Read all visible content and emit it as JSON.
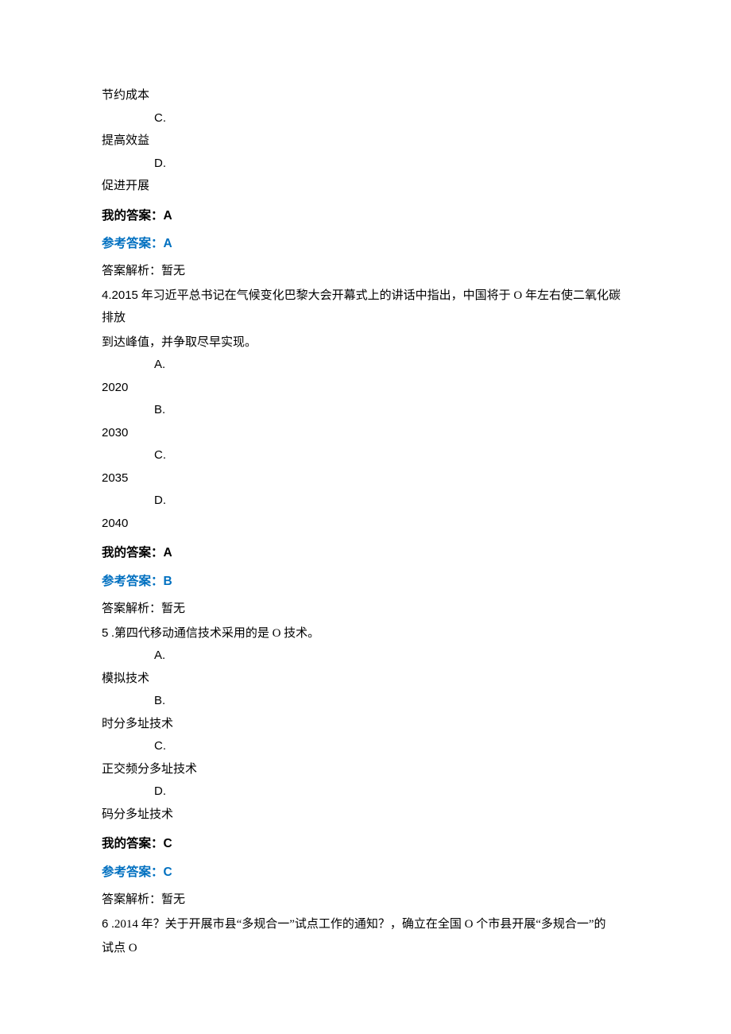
{
  "lead_options": {
    "opt_b_text": "节约成本",
    "opt_c_label": "C.",
    "opt_c_text": "提高效益",
    "opt_d_label": "D.",
    "opt_d_text": "促进开展"
  },
  "q3": {
    "my_label": "我的答案：",
    "my_value": "A",
    "ref_label": "参考答案：",
    "ref_value": "A",
    "explain": "答案解析：暂无"
  },
  "q4": {
    "stem_prefix": "4.2015",
    "stem_rest_1": " 年习近平总书记在气候变化巴黎大会开幕式上的讲话中指出，中国将于 O 年左右使二氧化碳排放",
    "stem_line2": "到达峰值，并争取尽早实现。",
    "a_label": "A.",
    "a_text": "2020",
    "b_label": "B.",
    "b_text": "2030",
    "c_label": "C.",
    "c_text": "2035",
    "d_label": "D.",
    "d_text": "2040",
    "my_label": "我的答案：",
    "my_value": "A",
    "ref_label": "参考答案：",
    "ref_value": "B",
    "explain": "答案解析：暂无"
  },
  "q5": {
    "stem_num": "5",
    "stem_rest": " .第四代移动通信技术采用的是 O 技术。",
    "a_label": "A.",
    "a_text": "模拟技术",
    "b_label": "B.",
    "b_text": "时分多址技术",
    "c_label": "C.",
    "c_text": "正交频分多址技术",
    "d_label": "D.",
    "d_text": "码分多址技术",
    "my_label": "我的答案：",
    "my_value": "C",
    "ref_label": "参考答案：",
    "ref_value": "C",
    "explain": "答案解析：暂无"
  },
  "q6": {
    "stem_num": "6",
    "stem_rest": " .2014 年？关于开展市县“多规合一”试点工作的通知？，确立在全国 O 个市县开展“多规合一”的",
    "stem_line2": "试点 O"
  }
}
